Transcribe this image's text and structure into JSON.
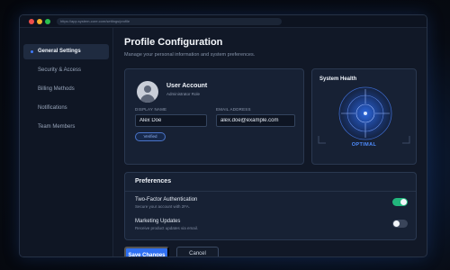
{
  "window": {
    "url": "https://app.system-core.com/settings/profile"
  },
  "sidebar": {
    "items": [
      {
        "label": "General Settings",
        "active": true
      },
      {
        "label": "Security & Access"
      },
      {
        "label": "Billing Methods"
      },
      {
        "label": "Notifications"
      },
      {
        "label": "Team Members"
      }
    ]
  },
  "page": {
    "title": "Profile Configuration",
    "subtitle": "Manage your personal information and system preferences."
  },
  "account": {
    "title": "User Account",
    "role": "Administrator Role",
    "display_name_label": "DISPLAY NAME",
    "display_name_value": "Alex Doe",
    "email_label": "EMAIL ADDRESS",
    "email_value": "alex.doe@example.com",
    "badge": "Verified"
  },
  "health": {
    "title": "System Health",
    "status": "OPTIMAL"
  },
  "preferences": {
    "title": "Preferences",
    "items": [
      {
        "title": "Two-Factor Authentication",
        "desc": "Secure your account with 2FA.",
        "enabled": true
      },
      {
        "title": "Marketing Updates",
        "desc": "Receive product updates via email.",
        "enabled": false
      }
    ]
  },
  "actions": {
    "save": "Save Changes",
    "cancel": "Cancel"
  },
  "colors": {
    "accent": "#2f6ff0",
    "toggle_on": "#22b67c",
    "health": "#4f8dff"
  }
}
